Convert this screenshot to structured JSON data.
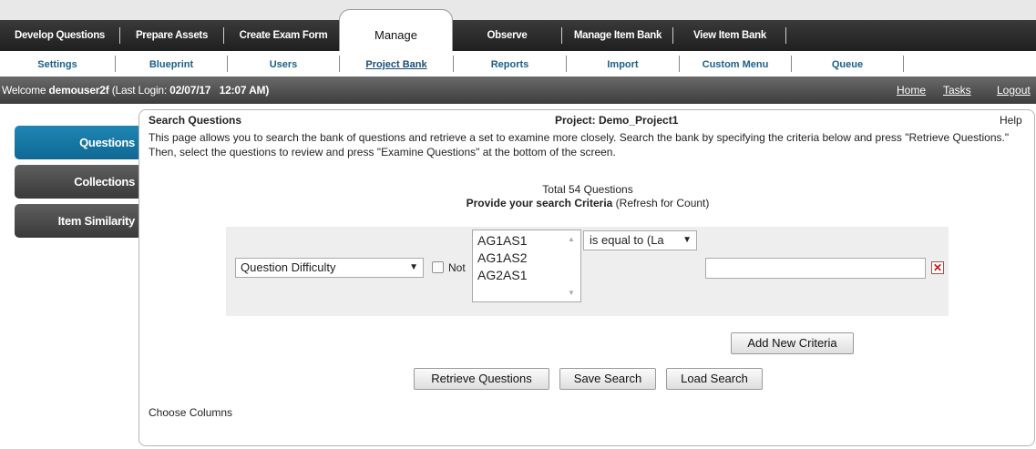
{
  "main_nav": {
    "tabs": [
      "Develop Questions",
      "Prepare Assets",
      "Create Exam Form",
      "Manage",
      "Observe",
      "Manage Item Bank",
      "View Item Bank"
    ],
    "active": "Manage"
  },
  "sub_nav": {
    "tabs": [
      "Settings",
      "Blueprint",
      "Users",
      "Project Bank",
      "Reports",
      "Import",
      "Custom Menu",
      "Queue"
    ],
    "active": "Project Bank"
  },
  "welcome": {
    "prefix": "Welcome",
    "user": "demouser2f",
    "login_label": "(Last Login:",
    "login_time": "02/07/17   12:07 AM)",
    "links": [
      "Home",
      "Tasks",
      "Logout"
    ]
  },
  "sidebar": {
    "items": [
      "Questions",
      "Collections",
      "Item Similarity"
    ],
    "active": "Questions"
  },
  "panel": {
    "title": "Search Questions",
    "project": "Project: Demo_Project1",
    "help": "Help",
    "description": "This page allows you to search the bank of questions and retrieve a set to examine more closely. Search the bank by specifying the criteria below and press \"Retrieve Questions.\" Then, select the questions to review and press \"Examine Questions\" at the bottom of the screen.",
    "total": "Total 54 Questions",
    "provide_bold": "Provide your search Criteria",
    "provide_rest": " (Refresh for Count)"
  },
  "criteria": {
    "field_value": "Question Difficulty",
    "not_label": "Not",
    "not_checked": false,
    "list_items": [
      "AG1AS1",
      "AG1AS2",
      "AG2AS1"
    ],
    "operator_value": "is equal to (La",
    "value_input": ""
  },
  "buttons": {
    "add_criteria": "Add New Criteria",
    "retrieve": "Retrieve Questions",
    "save_search": "Save Search",
    "load_search": "Load Search",
    "choose_columns": "Choose Columns"
  },
  "colors": {
    "active_side": "#1f86b3",
    "nav_dark": "#2b2b2b",
    "sub_link": "#1a5f8a",
    "remove_icon": "#cc1111"
  }
}
